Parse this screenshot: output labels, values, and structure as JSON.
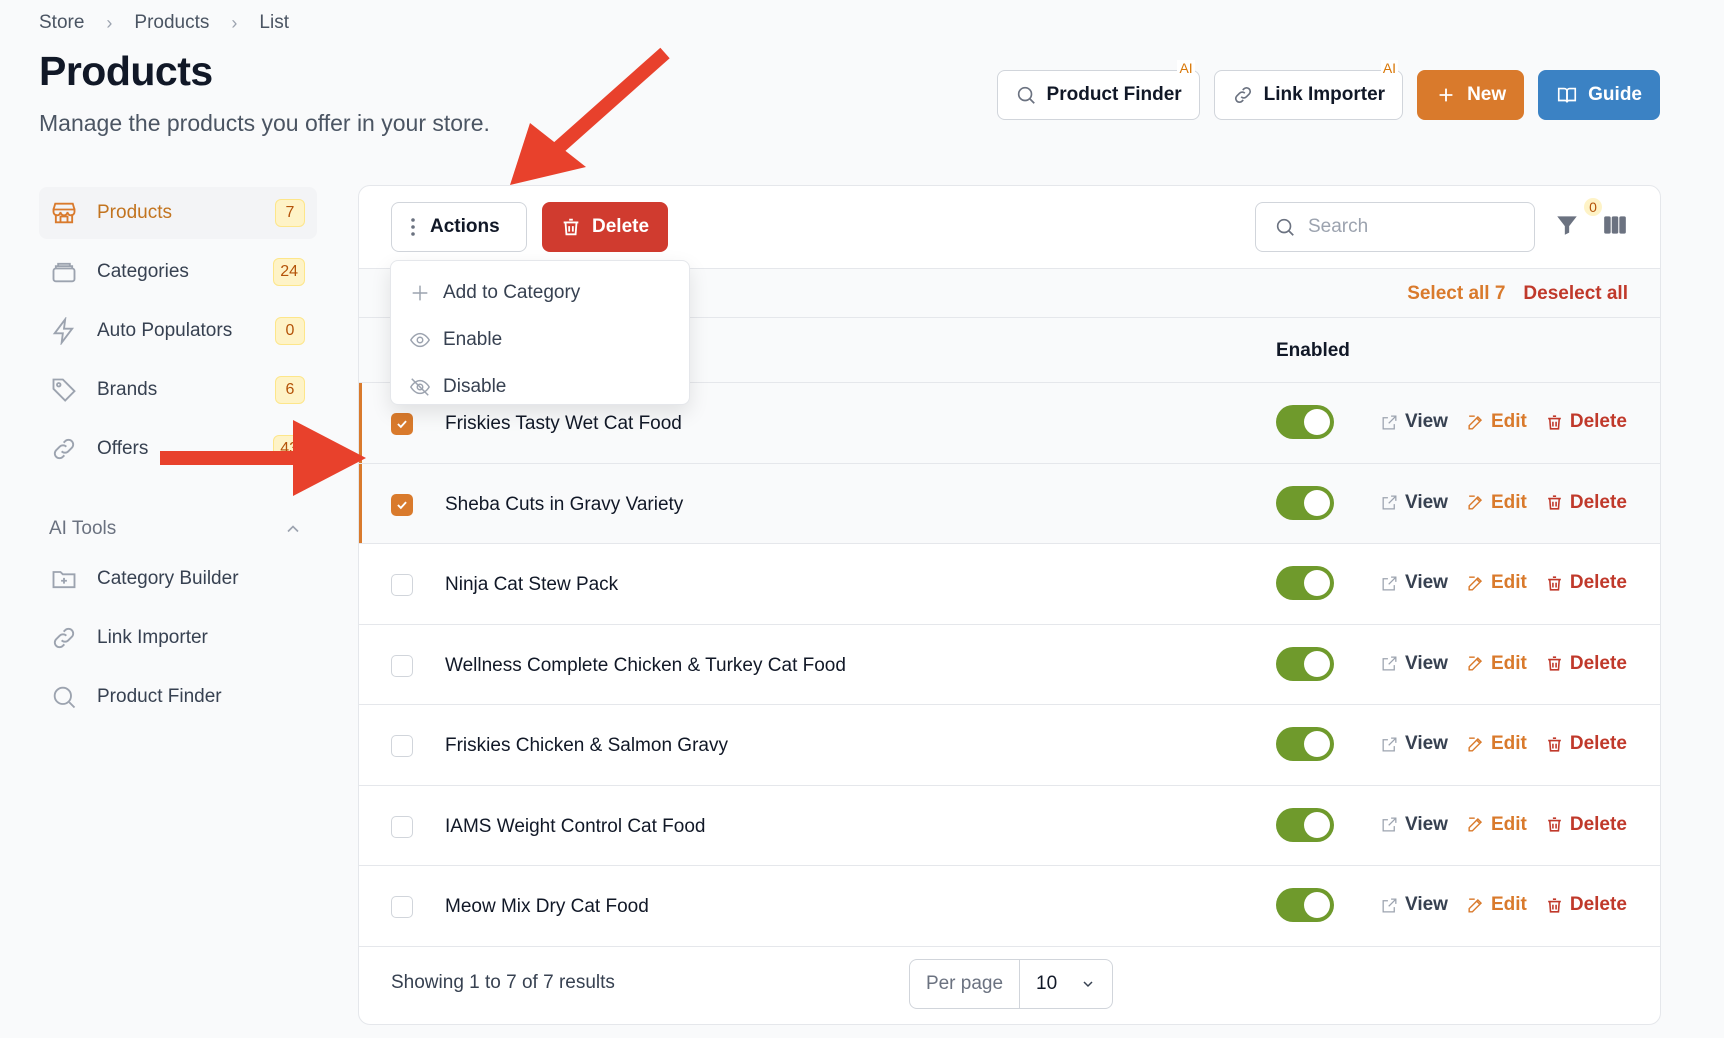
{
  "breadcrumb": [
    "Store",
    "Products",
    "List"
  ],
  "page": {
    "title": "Products",
    "subtitle": "Manage the products you offer in your store."
  },
  "header_buttons": {
    "product_finder": "Product Finder",
    "link_importer": "Link Importer",
    "ai_badge": "AI",
    "new": "New",
    "guide": "Guide"
  },
  "sidebar": {
    "items": [
      {
        "label": "Products",
        "count": "7",
        "icon": "store-icon"
      },
      {
        "label": "Categories",
        "count": "24",
        "icon": "stack-icon"
      },
      {
        "label": "Auto Populators",
        "count": "0",
        "icon": "bolt-icon"
      },
      {
        "label": "Brands",
        "count": "6",
        "icon": "tag-icon"
      },
      {
        "label": "Offers",
        "count": "43",
        "icon": "link-icon"
      }
    ],
    "group_label": "AI Tools",
    "tools": [
      {
        "label": "Category Builder",
        "icon": "folder-plus-icon"
      },
      {
        "label": "Link Importer",
        "icon": "link-icon"
      },
      {
        "label": "Product Finder",
        "icon": "search-icon"
      }
    ]
  },
  "toolbar": {
    "actions_label": "Actions",
    "delete_label": "Delete",
    "search_placeholder": "Search",
    "filter_count": "0"
  },
  "selection": {
    "select_all": "Select all 7",
    "deselect_all": "Deselect all"
  },
  "dropdown": {
    "items": [
      "Add to Category",
      "Enable",
      "Disable"
    ]
  },
  "table": {
    "columns": {
      "enabled": "Enabled"
    },
    "action_labels": {
      "view": "View",
      "edit": "Edit",
      "delete": "Delete"
    },
    "rows": [
      {
        "name": "Friskies Tasty Wet Cat Food",
        "selected": true,
        "enabled": true
      },
      {
        "name": "Sheba Cuts in Gravy Variety",
        "selected": true,
        "enabled": true
      },
      {
        "name": "Ninja Cat Stew Pack",
        "selected": false,
        "enabled": true
      },
      {
        "name": "Wellness Complete Chicken & Turkey Cat Food",
        "selected": false,
        "enabled": true
      },
      {
        "name": "Friskies Chicken & Salmon Gravy",
        "selected": false,
        "enabled": true
      },
      {
        "name": "IAMS Weight Control Cat Food",
        "selected": false,
        "enabled": true
      },
      {
        "name": "Meow Mix Dry Cat Food",
        "selected": false,
        "enabled": true
      }
    ]
  },
  "footer": {
    "showing": "Showing 1 to 7 of 7 results",
    "per_page_label": "Per page",
    "per_page_value": "10"
  },
  "colors": {
    "accent": "#d97a2c",
    "danger": "#d03b2f",
    "guide": "#3b82c4",
    "toggle_on": "#6f9a2c",
    "annotation_arrow": "#e8412c"
  }
}
